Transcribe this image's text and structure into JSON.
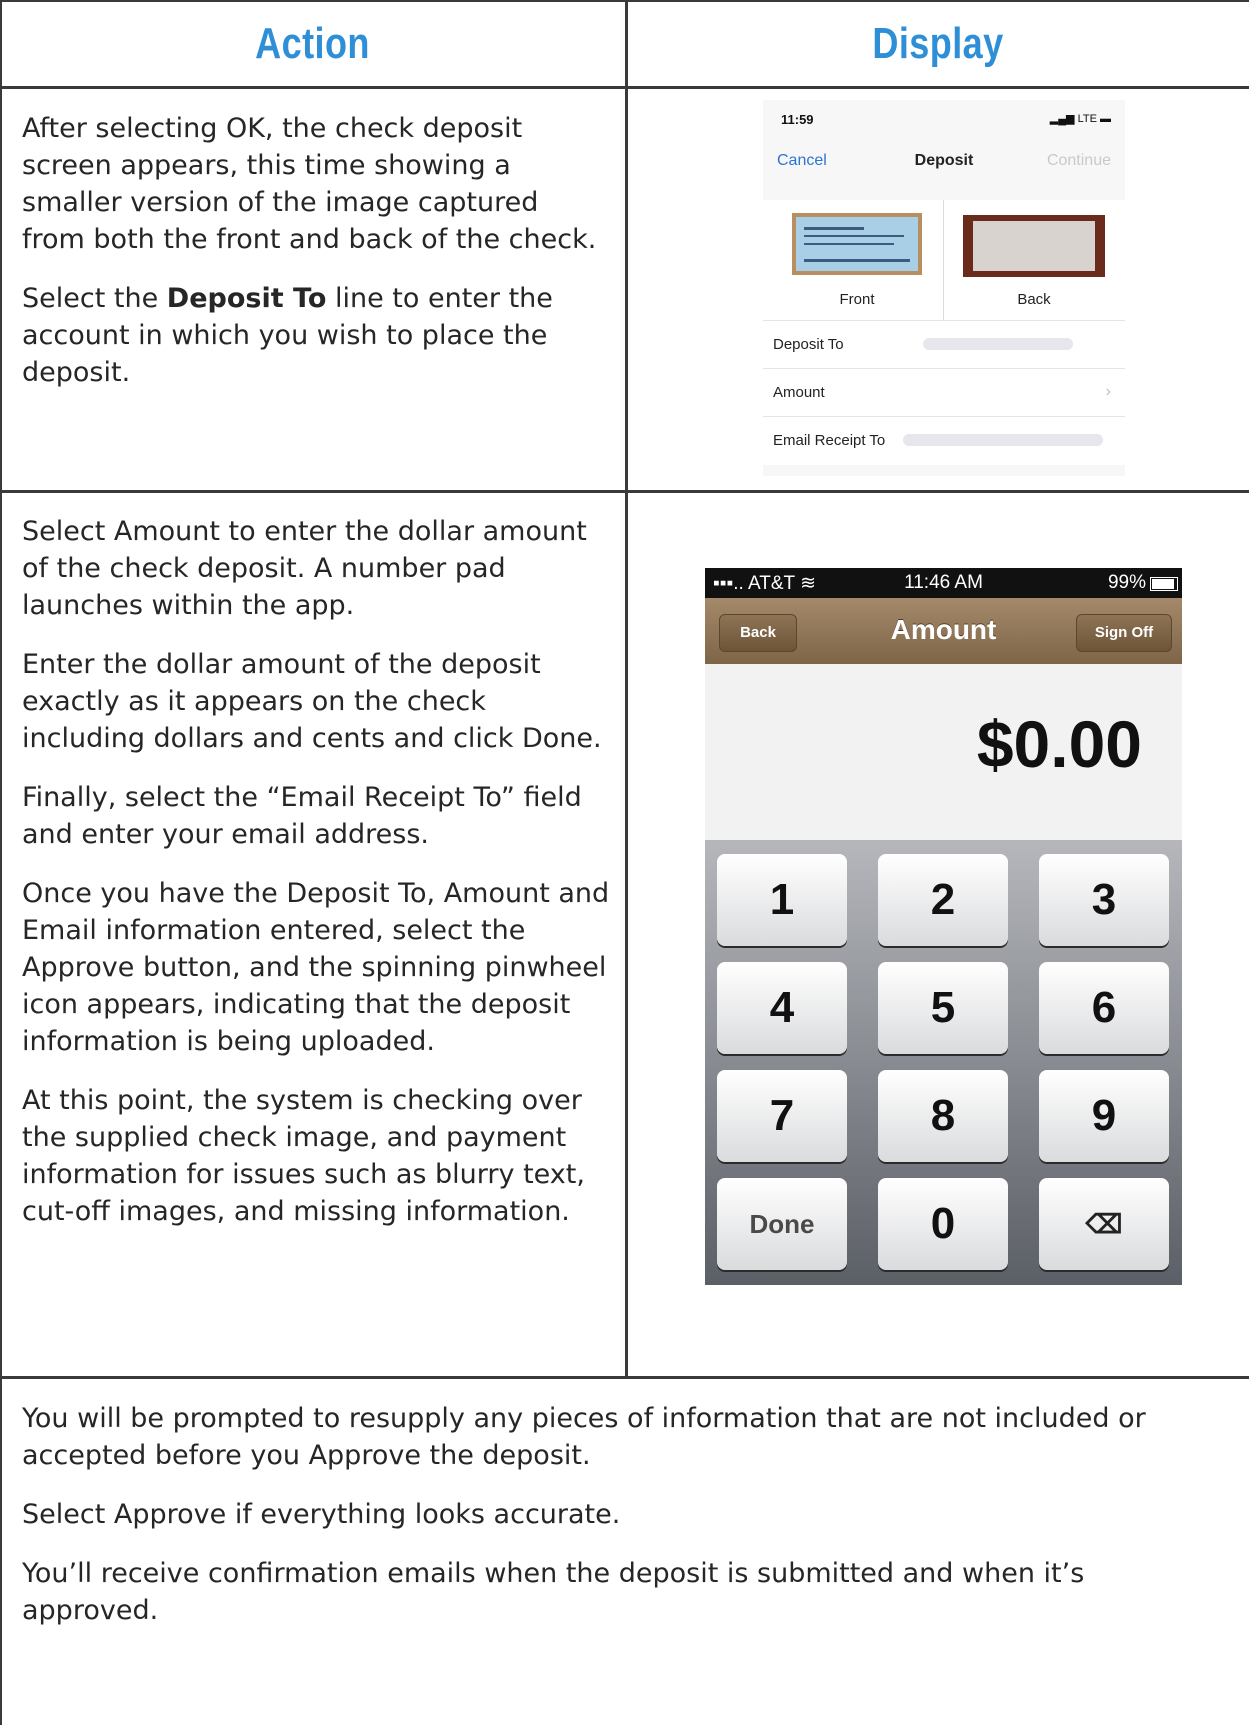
{
  "headers": {
    "action": "Action",
    "display": "Display"
  },
  "row1": {
    "p1": "After selecting OK, the check deposit screen appears, this time showing a smaller version of the image captured from both the front and back of the check.",
    "p2_pre": "Select the ",
    "p2_bold": "Deposit To",
    "p2_post": " line to enter the account in which you wish to place the deposit."
  },
  "row2": {
    "p1": "Select Amount to enter the dollar amount of the check deposit. A number pad launches within the app.",
    "p2": "Enter the dollar amount of the deposit exactly as it appears on the check including dollars and cents and click Done.",
    "p3": "Finally, select the “Email Receipt To” field and enter your email address.",
    "p4": "Once you have the Deposit To, Amount and Email information entered, select the Approve button, and the spinning pinwheel icon appears, indicating that the deposit information is being uploaded.",
    "p5": "At this point, the system is checking over the supplied check image, and payment information for issues such as blurry text, cut-off images, and missing information."
  },
  "footer": {
    "p1": "You will be prompted to resupply any pieces of information that are not included or accepted before you Approve the deposit.",
    "p2": "Select Approve if everything looks accurate.",
    "p3": "You’ll receive confirmation emails when the deposit is submitted and when it’s approved."
  },
  "screen1": {
    "time": "11:59",
    "signal": "LTE",
    "cancel": "Cancel",
    "title": "Deposit",
    "continue": "Continue",
    "front": "Front",
    "back": "Back",
    "rows": [
      "Deposit To",
      "Amount",
      "Email Receipt To"
    ],
    "chevron": "›"
  },
  "screen2": {
    "carrier": "AT&T",
    "time": "11:46 AM",
    "battery": "99%",
    "back": "Back",
    "title": "Amount",
    "signoff": "Sign Off",
    "amount": "$0.00",
    "keys": [
      "1",
      "2",
      "3",
      "4",
      "5",
      "6",
      "7",
      "8",
      "9",
      "Done",
      "0",
      "⌫"
    ]
  }
}
